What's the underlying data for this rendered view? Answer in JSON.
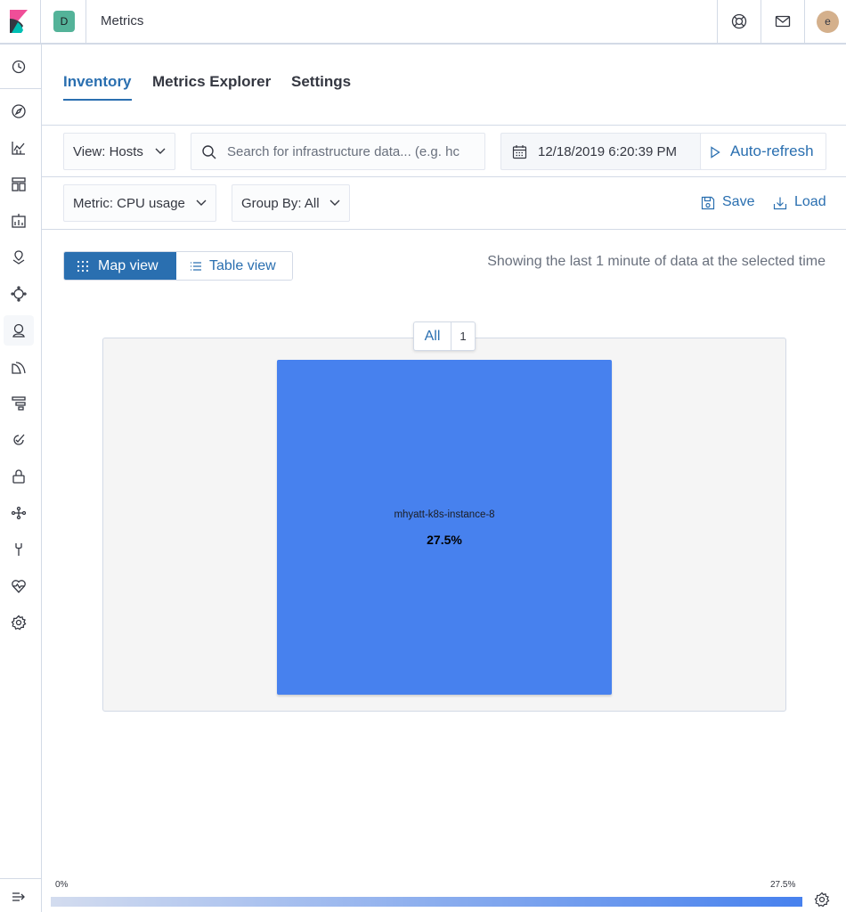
{
  "header": {
    "space_initial": "D",
    "app_title": "Metrics",
    "user_initial": "e"
  },
  "nav": {
    "items": [
      {
        "icon": "clock-icon",
        "label": "Recently viewed"
      },
      {
        "icon": "compass-icon",
        "label": "Discover"
      },
      {
        "icon": "visualize-icon",
        "label": "Visualize"
      },
      {
        "icon": "dashboard-icon",
        "label": "Dashboard"
      },
      {
        "icon": "canvas-icon",
        "label": "Canvas"
      },
      {
        "icon": "maps-icon",
        "label": "Maps"
      },
      {
        "icon": "ml-icon",
        "label": "Machine Learning"
      },
      {
        "icon": "metrics-icon",
        "label": "Metrics"
      },
      {
        "icon": "logs-icon",
        "label": "Logs"
      },
      {
        "icon": "apm-icon",
        "label": "APM"
      },
      {
        "icon": "uptime-icon",
        "label": "Uptime"
      },
      {
        "icon": "siem-icon",
        "label": "SIEM"
      },
      {
        "icon": "graph-icon",
        "label": "Graph"
      },
      {
        "icon": "devtools-icon",
        "label": "Dev Tools"
      },
      {
        "icon": "monitoring-icon",
        "label": "Stack Monitoring"
      },
      {
        "icon": "gear-icon",
        "label": "Management"
      }
    ],
    "active_index": 7,
    "collapse_icon": "collapse-menu-icon"
  },
  "tabs": [
    "Inventory",
    "Metrics Explorer",
    "Settings"
  ],
  "selected_tab": 0,
  "toolbar": {
    "view_label": "View: Hosts",
    "search_placeholder": "Search for infrastructure data... (e.g. hc",
    "date_value": "12/18/2019 6:20:39 PM",
    "auto_refresh_label": "Auto-refresh",
    "metric_label": "Metric: CPU usage",
    "group_by_label": "Group By: All",
    "save_label": "Save",
    "load_label": "Load"
  },
  "view_toggle": {
    "map_label": "Map view",
    "table_label": "Table view",
    "selected": "map"
  },
  "showing_text": "Showing the last 1 minute of data at the selected time",
  "map": {
    "group": {
      "name": "All",
      "count": "1"
    },
    "nodes": [
      {
        "name": "mhyatt-k8s-instance-8",
        "value": "27.5%"
      }
    ]
  },
  "legend": {
    "min_label": "0%",
    "max_label": "27.5%"
  },
  "colors": {
    "accent": "#2a6fb0",
    "node_fill": "#4781ee",
    "legend_low": "#d3dcef",
    "legend_high": "#4781ee"
  }
}
